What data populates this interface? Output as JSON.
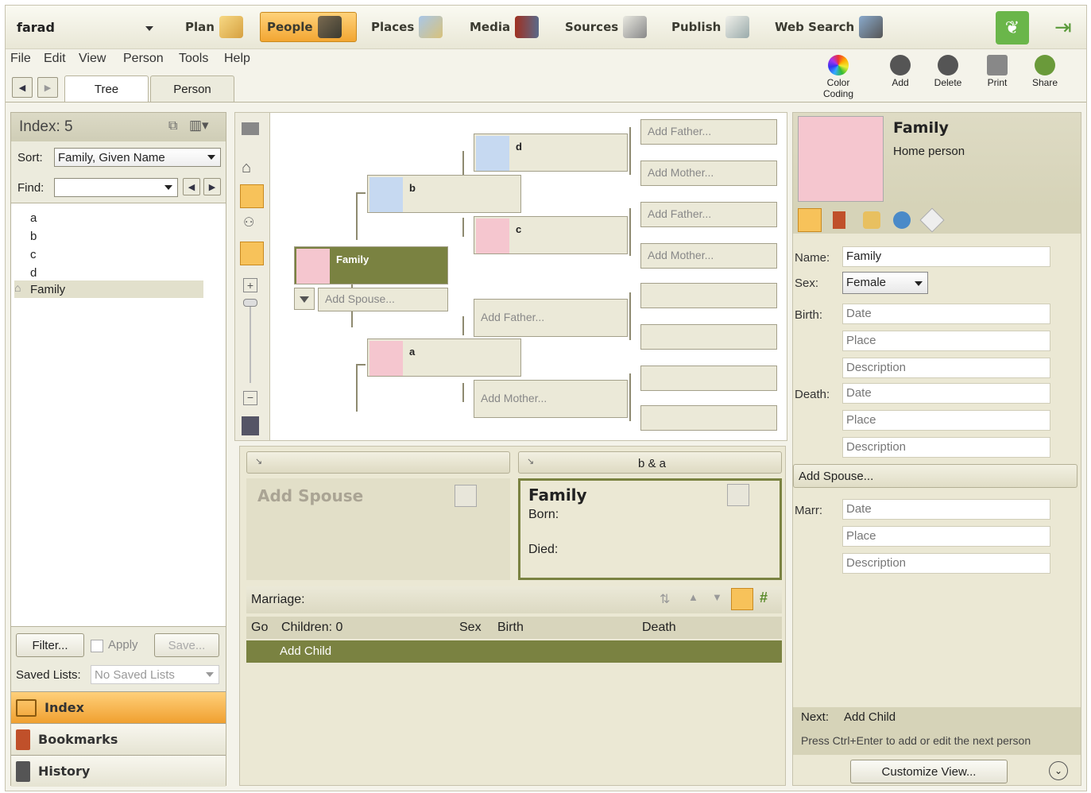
{
  "topnav": {
    "user": "farad",
    "tabs": [
      {
        "label": "Plan"
      },
      {
        "label": "People"
      },
      {
        "label": "Places"
      },
      {
        "label": "Media"
      },
      {
        "label": "Sources"
      },
      {
        "label": "Publish"
      },
      {
        "label": "Web Search"
      }
    ]
  },
  "menu": [
    "File",
    "Edit",
    "View",
    "Person",
    "Tools",
    "Help"
  ],
  "view_tabs": [
    "Tree",
    "Person"
  ],
  "toolbar": {
    "color_coding": "Color Coding",
    "add": "Add",
    "delete": "Delete",
    "print": "Print",
    "share": "Share"
  },
  "index": {
    "title": "Index: 5",
    "sort_label": "Sort:",
    "sort_value": "Family, Given Name",
    "find_label": "Find:",
    "find_value": "",
    "items": [
      "a",
      "b",
      "c",
      "d",
      "Family"
    ],
    "filter": "Filter...",
    "apply": "Apply",
    "save": "Save...",
    "saved_lists_label": "Saved Lists:",
    "saved_lists_value": "No Saved Lists"
  },
  "sidebar": {
    "index": "Index",
    "bookmarks": "Bookmarks",
    "history": "History"
  },
  "tree": {
    "root": "Family",
    "add_spouse": "Add Spouse...",
    "father": "b",
    "mother": "a",
    "gf_pat": "d",
    "gm_pat": "c",
    "add_father": "Add Father...",
    "add_mother": "Add Mother...",
    "add_father_short": "Add Father...",
    "add_mother_short": "Add Mother..."
  },
  "family": {
    "header_right": "b & a",
    "add_spouse": "Add Spouse",
    "person_name": "Family",
    "born_label": "Born:",
    "died_label": "Died:",
    "marriage_label": "Marriage:",
    "columns": [
      "Go",
      "Children: 0",
      "Sex",
      "Birth",
      "Death"
    ],
    "add_child": "Add Child"
  },
  "editor": {
    "name": "Family",
    "subtitle": "Home person",
    "name_label": "Name:",
    "name_value": "Family",
    "sex_label": "Sex:",
    "sex_value": "Female",
    "birth_label": "Birth:",
    "death_label": "Death:",
    "marr_label": "Marr:",
    "date_ph": "Date",
    "place_ph": "Place",
    "desc_ph": "Description",
    "add_spouse": "Add Spouse...",
    "next_label": "Next:",
    "next_value": "Add Child",
    "hint": "Press Ctrl+Enter to add or edit the next person",
    "customize": "Customize View..."
  },
  "colors": {
    "accent": "#f2a632",
    "tree_root": "#7a8241",
    "male": "#c6d9f1",
    "female": "#f5c6cf"
  }
}
